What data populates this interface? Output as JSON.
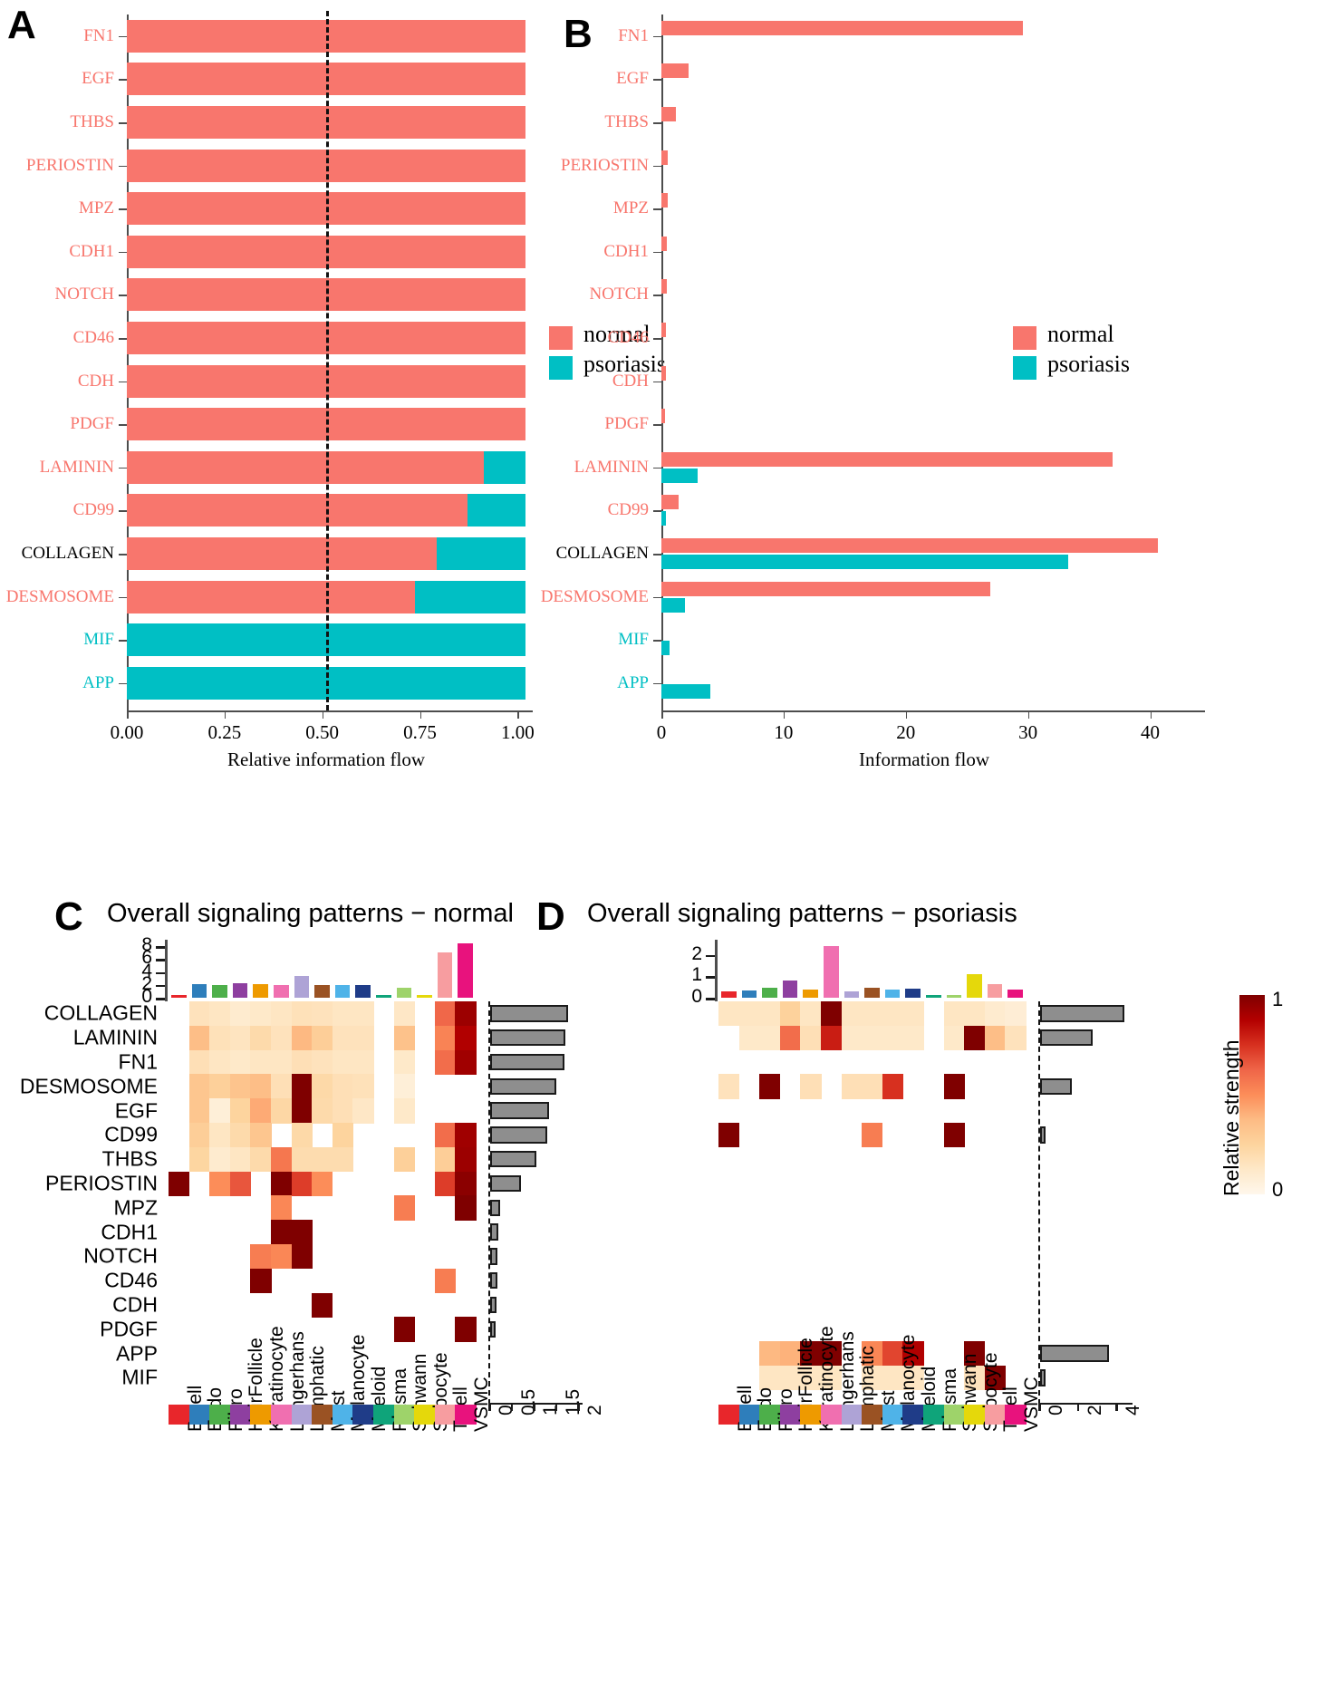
{
  "panels": {
    "a": {
      "letter": "A"
    },
    "b": {
      "letter": "B"
    },
    "c": {
      "letter": "C",
      "title": "Overall signaling patterns − normal"
    },
    "d": {
      "letter": "D",
      "title": "Overall signaling patterns − psoriasis"
    }
  },
  "legend": {
    "normal_label": "normal",
    "psoriasis_label": "psoriasis",
    "normal_color": "#F8766D",
    "psoriasis_color": "#00BFC4"
  },
  "colorbar": {
    "title": "Relative strength",
    "max_label": "1",
    "min_label": "0",
    "low_color": "#FFF7EC",
    "high_color": "#7F0000"
  },
  "chart_data": [
    {
      "type": "bar",
      "id": "panel-a",
      "title": "",
      "xlabel": "Relative information flow",
      "ylabel": "",
      "xlim": [
        0,
        1.02
      ],
      "xticks": [
        0,
        0.25,
        0.5,
        0.75,
        1.0
      ],
      "xticklabels": [
        "0.00",
        "0.25",
        "0.50",
        "0.75",
        "1.00"
      ],
      "reference_line": 0.5,
      "grid": false,
      "stacked": true,
      "legend_position": "right",
      "series": [
        {
          "name": "normal",
          "color": "#F8766D"
        },
        {
          "name": "psoriasis",
          "color": "#00BFC4"
        }
      ],
      "categories": [
        "FN1",
        "EGF",
        "THBS",
        "PERIOSTIN",
        "MPZ",
        "CDH1",
        "NOTCH",
        "CD46",
        "CDH",
        "PDGF",
        "LAMININ",
        "CD99",
        "COLLAGEN",
        "DESMOSOME",
        "MIF",
        "APP"
      ],
      "label_colors": [
        "#F8766D",
        "#F8766D",
        "#F8766D",
        "#F8766D",
        "#F8766D",
        "#F8766D",
        "#F8766D",
        "#F8766D",
        "#F8766D",
        "#F8766D",
        "#F8766D",
        "#F8766D",
        "#000000",
        "#F8766D",
        "#00BFC4",
        "#00BFC4"
      ],
      "normal_fraction": [
        1.0,
        1.0,
        1.0,
        1.0,
        1.0,
        1.0,
        1.0,
        1.0,
        1.0,
        1.0,
        0.895,
        0.855,
        0.777,
        0.723,
        0.0,
        0.0
      ],
      "psoriasis_fraction": [
        0.0,
        0.0,
        0.0,
        0.0,
        0.0,
        0.0,
        0.0,
        0.0,
        0.0,
        0.0,
        0.105,
        0.145,
        0.223,
        0.277,
        1.0,
        1.0
      ]
    },
    {
      "type": "bar",
      "id": "panel-b",
      "title": "",
      "xlabel": "Information flow",
      "ylabel": "",
      "xlim": [
        0,
        43
      ],
      "xticks": [
        0,
        10,
        20,
        30,
        40
      ],
      "xticklabels": [
        "0",
        "10",
        "20",
        "30",
        "40"
      ],
      "grid": false,
      "grouped": true,
      "legend_position": "right",
      "categories": [
        "FN1",
        "EGF",
        "THBS",
        "PERIOSTIN",
        "MPZ",
        "CDH1",
        "NOTCH",
        "CD46",
        "CDH",
        "PDGF",
        "LAMININ",
        "CD99",
        "COLLAGEN",
        "DESMOSOME",
        "MIF",
        "APP"
      ],
      "label_colors": [
        "#F8766D",
        "#F8766D",
        "#F8766D",
        "#F8766D",
        "#F8766D",
        "#F8766D",
        "#F8766D",
        "#F8766D",
        "#F8766D",
        "#F8766D",
        "#F8766D",
        "#F8766D",
        "#000000",
        "#F8766D",
        "#00BFC4",
        "#00BFC4"
      ],
      "series": [
        {
          "name": "normal",
          "color": "#F8766D",
          "values": [
            29.6,
            2.2,
            1.2,
            0.55,
            0.5,
            0.45,
            0.42,
            0.4,
            0.38,
            0.3,
            36.9,
            1.4,
            40.6,
            26.9,
            0.0,
            0.0
          ]
        },
        {
          "name": "psoriasis",
          "color": "#00BFC4",
          "values": [
            0.0,
            0.0,
            0.0,
            0.0,
            0.0,
            0.0,
            0.0,
            0.0,
            0.0,
            0.0,
            3.0,
            0.35,
            33.3,
            1.9,
            0.7,
            4.0
          ]
        }
      ]
    },
    {
      "type": "heatmap",
      "id": "panel-c",
      "title": "Overall signaling patterns − normal",
      "colorbar_label": "Relative strength",
      "zlim": [
        0,
        1
      ],
      "top_bar_axis": {
        "ticks": [
          0,
          2,
          4,
          6,
          8
        ],
        "ticklabels": [
          "0",
          "2",
          "4",
          "6",
          "8"
        ],
        "max": 9
      },
      "right_bar_axis": {
        "ticks": [
          0,
          0.5,
          1,
          1.5,
          2
        ],
        "ticklabels": [
          "0",
          "0.5",
          "1",
          "1.5",
          "2"
        ],
        "max": 2
      },
      "columns": [
        "B cell",
        "Endo",
        "Fibro",
        "HairFollicle",
        "Keratinocyte",
        "Langerhans",
        "Lymphatic",
        "Mast",
        "Melanocyte",
        "Myeloid",
        "Plasma",
        "Schwann",
        "Sebocyte",
        "T cell",
        "VSMC"
      ],
      "column_colors": [
        "#E8262B",
        "#2E7EBB",
        "#4DAF4A",
        "#8E3FA0",
        "#EE9A00",
        "#F06FB0",
        "#AEA3D6",
        "#9A5223",
        "#4FB3E8",
        "#1F3C88",
        "#0FA47A",
        "#9ED36A",
        "#E5D80B",
        "#F79DA0",
        "#E8127D"
      ],
      "rows": [
        "COLLAGEN",
        "LAMININ",
        "FN1",
        "DESMOSOME",
        "EGF",
        "CD99",
        "THBS",
        "PERIOSTIN",
        "MPZ",
        "CDH1",
        "NOTCH",
        "CD46",
        "CDH",
        "PDGF",
        "APP",
        "MIF"
      ],
      "top_bar_values": [
        0.08,
        2.1,
        2.0,
        2.2,
        2.1,
        1.9,
        3.4,
        2.0,
        1.9,
        1.9,
        0.15,
        1.6,
        0.12,
        7.0,
        8.5
      ],
      "right_bar_values": [
        1.75,
        1.7,
        1.68,
        1.48,
        1.32,
        1.28,
        1.05,
        0.7,
        0.23,
        0.19,
        0.17,
        0.16,
        0.14,
        0.13,
        0.0,
        0.0
      ],
      "matrix": [
        [
          0.0,
          0.16,
          0.14,
          0.1,
          0.12,
          0.14,
          0.17,
          0.16,
          0.14,
          0.14,
          0.0,
          0.13,
          0.0,
          0.62,
          0.93
        ],
        [
          0.0,
          0.36,
          0.17,
          0.15,
          0.21,
          0.16,
          0.38,
          0.28,
          0.16,
          0.16,
          0.0,
          0.34,
          0.0,
          0.53,
          0.88
        ],
        [
          0.0,
          0.18,
          0.14,
          0.12,
          0.14,
          0.14,
          0.18,
          0.16,
          0.14,
          0.14,
          0.0,
          0.12,
          0.0,
          0.6,
          0.92
        ],
        [
          0.0,
          0.32,
          0.27,
          0.33,
          0.36,
          0.18,
          1.0,
          0.22,
          0.18,
          0.17,
          0.0,
          0.07,
          0.0,
          0.0,
          0.0
        ],
        [
          0.0,
          0.32,
          0.07,
          0.25,
          0.42,
          0.23,
          1.0,
          0.21,
          0.18,
          0.13,
          0.0,
          0.12,
          0.0,
          0.0,
          0.0
        ],
        [
          0.0,
          0.28,
          0.14,
          0.21,
          0.32,
          0.0,
          0.22,
          0.0,
          0.25,
          0.0,
          0.0,
          0.0,
          0.0,
          0.6,
          0.92
        ],
        [
          0.0,
          0.24,
          0.1,
          0.14,
          0.21,
          0.57,
          0.2,
          0.2,
          0.2,
          0.0,
          0.0,
          0.27,
          0.0,
          0.28,
          0.93
        ],
        [
          1.0,
          0.0,
          0.5,
          0.66,
          0.0,
          1.0,
          0.72,
          0.5,
          0.0,
          0.0,
          0.0,
          0.0,
          0.0,
          0.72,
          0.97
        ],
        [
          0.0,
          0.0,
          0.0,
          0.0,
          0.0,
          0.52,
          0.0,
          0.0,
          0.0,
          0.0,
          0.0,
          0.55,
          0.0,
          0.0,
          1.0
        ],
        [
          0.0,
          0.0,
          0.0,
          0.0,
          0.0,
          1.0,
          1.0,
          0.0,
          0.0,
          0.0,
          0.0,
          0.0,
          0.0,
          0.0,
          0.0
        ],
        [
          0.0,
          0.0,
          0.0,
          0.0,
          0.55,
          0.52,
          1.0,
          0.0,
          0.0,
          0.0,
          0.0,
          0.0,
          0.0,
          0.0,
          0.0
        ],
        [
          0.0,
          0.0,
          0.0,
          0.0,
          1.0,
          0.0,
          0.0,
          0.0,
          0.0,
          0.0,
          0.0,
          0.0,
          0.0,
          0.55,
          0.0
        ],
        [
          0.0,
          0.0,
          0.0,
          0.0,
          0.0,
          0.0,
          0.0,
          1.0,
          0.0,
          0.0,
          0.0,
          0.0,
          0.0,
          0.0,
          0.0
        ],
        [
          0.0,
          0.0,
          0.0,
          0.0,
          0.0,
          0.0,
          0.0,
          0.0,
          0.0,
          0.0,
          0.0,
          1.0,
          0.0,
          0.0,
          1.0
        ],
        [
          0.0,
          0.0,
          0.0,
          0.0,
          0.0,
          0.0,
          0.0,
          0.0,
          0.0,
          0.0,
          0.0,
          0.0,
          0.0,
          0.0,
          0.0
        ],
        [
          0.0,
          0.0,
          0.0,
          0.0,
          0.0,
          0.0,
          0.0,
          0.0,
          0.0,
          0.0,
          0.0,
          0.0,
          0.0,
          0.0,
          0.0
        ]
      ]
    },
    {
      "type": "heatmap",
      "id": "panel-d",
      "title": "Overall signaling patterns − psoriasis",
      "colorbar_label": "Relative strength",
      "zlim": [
        0,
        1
      ],
      "top_bar_axis": {
        "ticks": [
          0,
          1,
          2
        ],
        "ticklabels": [
          "0",
          "1",
          "2"
        ],
        "max": 2.7
      },
      "right_bar_axis": {
        "ticks": [
          0,
          2,
          4
        ],
        "ticklabels": [
          "0",
          "2",
          "4"
        ],
        "max": 4.6
      },
      "columns": [
        "B cell",
        "Endo",
        "Fibro",
        "HairFollicle",
        "Keratinocyte",
        "Langerhans",
        "Lymphatic",
        "Mast",
        "Melanocyte",
        "Myeloid",
        "Plasma",
        "Schwann",
        "Sebocyte",
        "T cell",
        "VSMC"
      ],
      "column_colors": [
        "#E8262B",
        "#2E7EBB",
        "#4DAF4A",
        "#8E3FA0",
        "#EE9A00",
        "#F06FB0",
        "#AEA3D6",
        "#9A5223",
        "#4FB3E8",
        "#1F3C88",
        "#0FA47A",
        "#9ED36A",
        "#E5D80B",
        "#F79DA0",
        "#E8127D"
      ],
      "rows": [
        "COLLAGEN",
        "LAMININ",
        "FN1",
        "DESMOSOME",
        "EGF",
        "CD99",
        "THBS",
        "PERIOSTIN",
        "MPZ",
        "CDH1",
        "NOTCH",
        "CD46",
        "CDH",
        "PDGF",
        "APP",
        "MIF"
      ],
      "top_bar_values": [
        0.3,
        0.35,
        0.45,
        0.82,
        0.4,
        2.4,
        0.3,
        0.47,
        0.38,
        0.42,
        0.04,
        0.08,
        1.1,
        0.62,
        0.4
      ],
      "right_bar_values": [
        4.35,
        2.7,
        0.0,
        1.65,
        0.0,
        0.2,
        0.0,
        0.0,
        0.0,
        0.0,
        0.0,
        0.0,
        0.0,
        0.0,
        3.55,
        0.25
      ],
      "matrix": [
        [
          0.14,
          0.14,
          0.14,
          0.26,
          0.14,
          1.0,
          0.14,
          0.14,
          0.14,
          0.14,
          0.0,
          0.14,
          0.14,
          0.1,
          0.08
        ],
        [
          0.0,
          0.12,
          0.12,
          0.6,
          0.18,
          0.8,
          0.12,
          0.12,
          0.12,
          0.12,
          0.0,
          0.12,
          1.0,
          0.36,
          0.16
        ],
        [
          0.0,
          0.0,
          0.0,
          0.0,
          0.0,
          0.0,
          0.0,
          0.0,
          0.0,
          0.0,
          0.0,
          0.0,
          0.0,
          0.0,
          0.0
        ],
        [
          0.16,
          0.0,
          1.0,
          0.0,
          0.18,
          0.0,
          0.18,
          0.18,
          0.75,
          0.0,
          0.0,
          1.0,
          0.0,
          0.0,
          0.0
        ],
        [
          0.0,
          0.0,
          0.0,
          0.0,
          0.0,
          0.0,
          0.0,
          0.0,
          0.0,
          0.0,
          0.0,
          0.0,
          0.0,
          0.0,
          0.0
        ],
        [
          1.0,
          0.0,
          0.0,
          0.0,
          0.0,
          0.0,
          0.0,
          0.55,
          0.0,
          0.0,
          0.0,
          1.0,
          0.0,
          0.0,
          0.0
        ],
        [
          0.0,
          0.0,
          0.0,
          0.0,
          0.0,
          0.0,
          0.0,
          0.0,
          0.0,
          0.0,
          0.0,
          0.0,
          0.0,
          0.0,
          0.0
        ],
        [
          0.0,
          0.0,
          0.0,
          0.0,
          0.0,
          0.0,
          0.0,
          0.0,
          0.0,
          0.0,
          0.0,
          0.0,
          0.0,
          0.0,
          0.0
        ],
        [
          0.0,
          0.0,
          0.0,
          0.0,
          0.0,
          0.0,
          0.0,
          0.0,
          0.0,
          0.0,
          0.0,
          0.0,
          0.0,
          0.0,
          0.0
        ],
        [
          0.0,
          0.0,
          0.0,
          0.0,
          0.0,
          0.0,
          0.0,
          0.0,
          0.0,
          0.0,
          0.0,
          0.0,
          0.0,
          0.0,
          0.0
        ],
        [
          0.0,
          0.0,
          0.0,
          0.0,
          0.0,
          0.0,
          0.0,
          0.0,
          0.0,
          0.0,
          0.0,
          0.0,
          0.0,
          0.0,
          0.0
        ],
        [
          0.0,
          0.0,
          0.0,
          0.0,
          0.0,
          0.0,
          0.0,
          0.0,
          0.0,
          0.0,
          0.0,
          0.0,
          0.0,
          0.0,
          0.0
        ],
        [
          0.0,
          0.0,
          0.0,
          0.0,
          0.0,
          0.0,
          0.0,
          0.0,
          0.0,
          0.0,
          0.0,
          0.0,
          0.0,
          0.0,
          0.0
        ],
        [
          0.0,
          0.0,
          0.0,
          0.0,
          0.0,
          0.0,
          0.0,
          0.0,
          0.0,
          0.0,
          0.0,
          0.0,
          0.0,
          0.0,
          0.0
        ],
        [
          0.0,
          0.0,
          0.38,
          0.4,
          1.0,
          1.0,
          0.0,
          0.52,
          0.7,
          0.88,
          0.0,
          0.0,
          1.0,
          0.0,
          0.0
        ],
        [
          0.0,
          0.0,
          0.14,
          0.14,
          0.14,
          0.14,
          0.0,
          0.14,
          0.14,
          0.14,
          0.0,
          0.0,
          0.16,
          1.0,
          0.0
        ]
      ]
    }
  ]
}
